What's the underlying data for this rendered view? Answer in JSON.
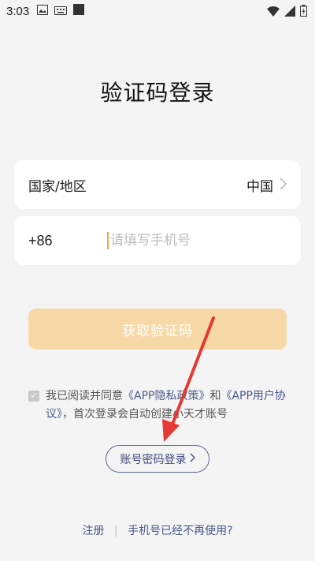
{
  "status_bar": {
    "time": "3:03",
    "left_icons": [
      "image-icon",
      "keyboard-icon",
      "square-icon"
    ],
    "right_icons": [
      "wifi-icon",
      "signal-icon",
      "battery-icon"
    ]
  },
  "page": {
    "title": "验证码登录"
  },
  "region": {
    "label": "国家/地区",
    "value": "中国"
  },
  "phone": {
    "prefix": "+86",
    "placeholder": "请填写手机号",
    "value": ""
  },
  "get_code_button": {
    "label": "获取验证码",
    "color": "#f7d9a8"
  },
  "agreement": {
    "checked": true,
    "prefix_text": "我已阅读并同意",
    "privacy_link": "《APP隐私政策》",
    "and_text": "和",
    "user_agreement_link": "《APP用户协议》",
    "suffix_text": "，首次登录会自动创建小天才账号"
  },
  "password_login_button": {
    "label": "账号密码登录"
  },
  "footer": {
    "register": "注册",
    "separator": "|",
    "phone_unused": "手机号已经不再使用?"
  },
  "colors": {
    "accent": "#f4a640",
    "link": "#4a5a8c",
    "annotation_arrow": "#e53935"
  }
}
